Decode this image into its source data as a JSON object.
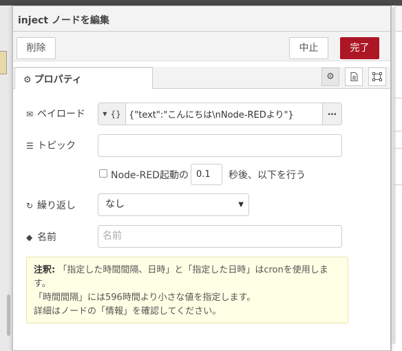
{
  "header": {
    "title": "inject ノードを編集"
  },
  "toolbar": {
    "delete_label": "削除",
    "cancel_label": "中止",
    "done_label": "完了"
  },
  "tabs": {
    "properties_label": "プロパティ"
  },
  "form": {
    "payload": {
      "label": "ペイロード",
      "type_symbol": "{}",
      "value": "{\"text\":\"こんにちは\\nNode-REDより\"}",
      "more": "…"
    },
    "topic": {
      "label": "トピック",
      "value": ""
    },
    "once": {
      "label": "Node-RED起動の",
      "delay": "0.1",
      "suffix": "秒後、以下を行う"
    },
    "repeat": {
      "label": "繰り返し",
      "selected": "なし"
    },
    "name": {
      "label": "名前",
      "placeholder": "名前"
    }
  },
  "note": {
    "prefix": "注釈:",
    "line1": " 「指定した時間間隔、日時」と「指定した日時」はcronを使用します。",
    "line2": "「時間間隔」には596時間より小さな値を指定します。",
    "line3": "詳細はノードの「情報」を確認してください。"
  },
  "colors": {
    "done_button": "#ad1625",
    "note_background": "#ffffe5"
  }
}
